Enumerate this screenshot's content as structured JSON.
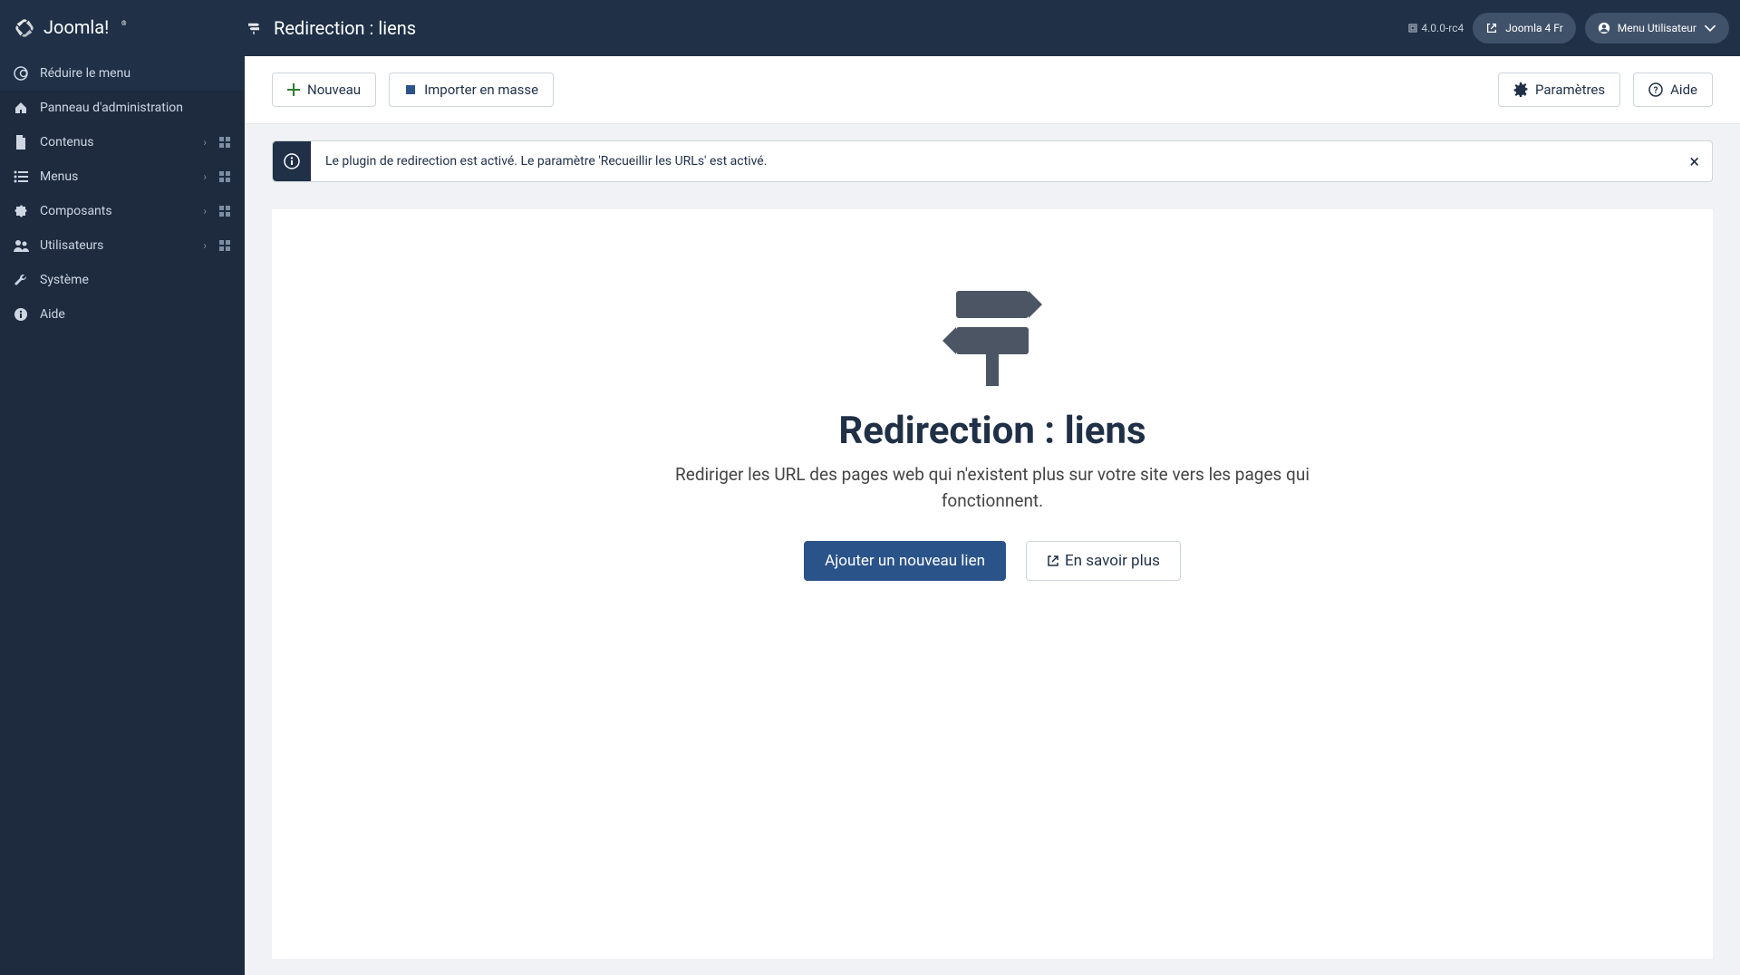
{
  "header": {
    "page_title": "Redirection : liens",
    "version": "4.0.0-rc4",
    "site_link": "Joomla 4 Fr",
    "user_menu": "Menu Utilisateur"
  },
  "sidebar": {
    "toggle": "Réduire le menu",
    "items": [
      {
        "label": "Panneau d'administration",
        "icon": "home",
        "expandable": false,
        "quick": false
      },
      {
        "label": "Contenus",
        "icon": "file",
        "expandable": true,
        "quick": true
      },
      {
        "label": "Menus",
        "icon": "list",
        "expandable": true,
        "quick": true
      },
      {
        "label": "Composants",
        "icon": "puzzle",
        "expandable": true,
        "quick": true
      },
      {
        "label": "Utilisateurs",
        "icon": "users",
        "expandable": true,
        "quick": true
      },
      {
        "label": "Système",
        "icon": "wrench",
        "expandable": false,
        "quick": false
      },
      {
        "label": "Aide",
        "icon": "info",
        "expandable": false,
        "quick": false
      }
    ]
  },
  "toolbar": {
    "new_label": "Nouveau",
    "import_label": "Importer en masse",
    "settings_label": "Paramètres",
    "help_label": "Aide"
  },
  "info": {
    "message": "Le plugin de redirection est activé. Le paramètre 'Recueillir les URLs' est activé."
  },
  "empty": {
    "title": "Redirection : liens",
    "description": "Rediriger les URL des pages web qui n'existent plus sur votre site vers les pages qui fonctionnent.",
    "add_button": "Ajouter un nouveau lien",
    "learn_button": "En savoir plus"
  }
}
